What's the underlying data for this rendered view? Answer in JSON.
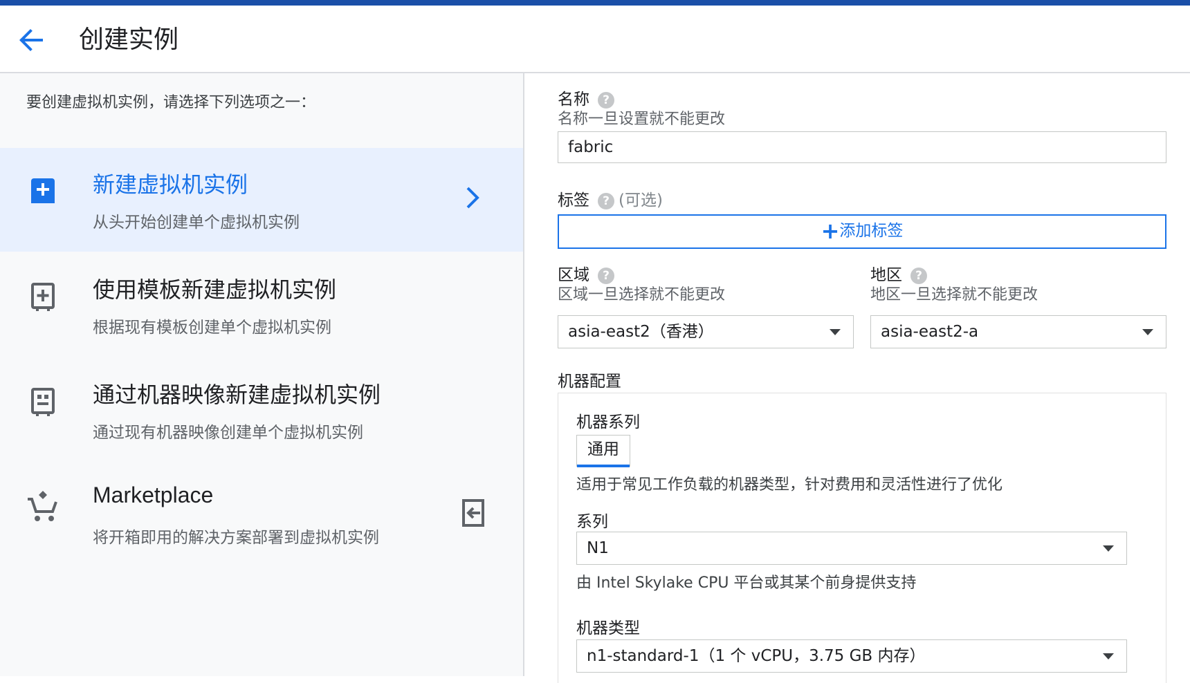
{
  "header": {
    "title": "创建实例"
  },
  "left": {
    "intro": "要创建虚拟机实例，请选择下列选项之一：",
    "options": [
      {
        "title": "新建虚拟机实例",
        "desc": "从头开始创建单个虚拟机实例",
        "icon": "add-box-filled-icon"
      },
      {
        "title": "使用模板新建虚拟机实例",
        "desc": "根据现有模板创建单个虚拟机实例",
        "icon": "template-add-icon"
      },
      {
        "title": "通过机器映像新建虚拟机实例",
        "desc": "通过现有机器映像创建单个虚拟机实例",
        "icon": "machine-image-icon"
      },
      {
        "title": "Marketplace",
        "desc": "将开箱即用的解决方案部署到虚拟机实例",
        "icon": "cart-icon"
      }
    ]
  },
  "form": {
    "name": {
      "label": "名称",
      "hint": "名称一旦设置就不能更改",
      "value": "fabric"
    },
    "labels": {
      "label": "标签",
      "optional": "(可选)",
      "add_button": "添加标签"
    },
    "region": {
      "label": "区域",
      "hint": "区域一旦选择就不能更改",
      "value": "asia-east2（香港）"
    },
    "zone": {
      "label": "地区",
      "hint": "地区一旦选择就不能更改",
      "value": "asia-east2-a"
    },
    "machine_config": {
      "label": "机器配置",
      "family_label": "机器系列",
      "family_chip": "通用",
      "family_desc": "适用于常见工作负载的机器类型，针对费用和灵活性进行了优化",
      "series_label": "系列",
      "series_value": "N1",
      "series_desc": "由 Intel Skylake CPU 平台或其某个前身提供支持",
      "type_label": "机器类型",
      "type_value": "n1-standard-1（1 个 vCPU，3.75 GB 内存）"
    }
  },
  "colors": {
    "accent": "#1a73e8",
    "topbar": "#1a4fa8",
    "selected_bg": "#e8f0fe"
  }
}
